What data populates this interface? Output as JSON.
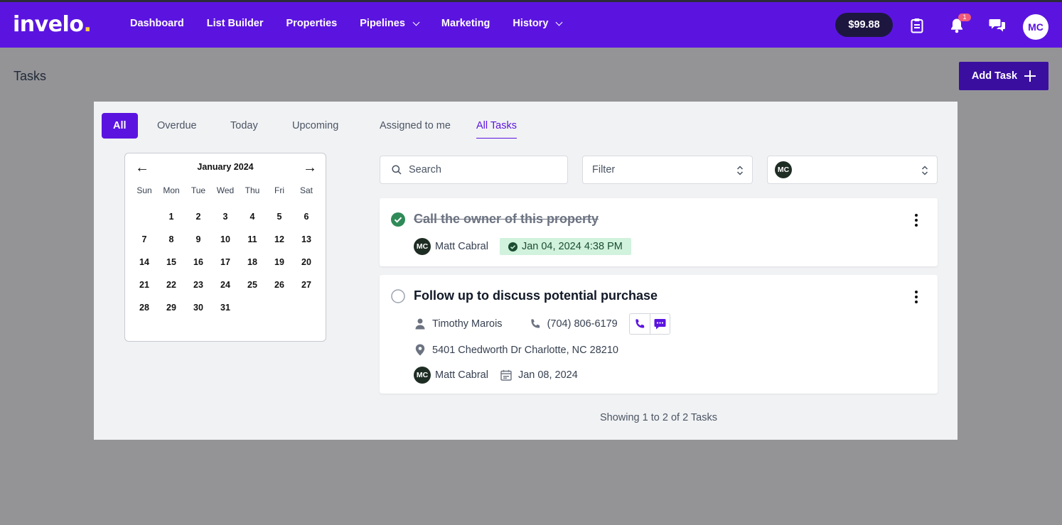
{
  "app": {
    "logo_text": "invelo",
    "logo_dot": ".",
    "nav": [
      {
        "label": "Dashboard"
      },
      {
        "label": "List Builder"
      },
      {
        "label": "Properties"
      },
      {
        "label": "Pipelines",
        "has_dropdown": true
      },
      {
        "label": "Marketing"
      },
      {
        "label": "History",
        "has_dropdown": true
      }
    ],
    "balance": "$99.88",
    "notification_count": "1",
    "user_initials": "MC",
    "icons": [
      "clipboard-icon",
      "bell-icon",
      "chat-icon"
    ],
    "brand_color": "#5b14e0"
  },
  "page": {
    "title": "Tasks",
    "add_task_label": "Add Task"
  },
  "tabs": {
    "status": [
      "All",
      "Overdue",
      "Today",
      "Upcoming"
    ],
    "active_status": "All",
    "scope": [
      "Assigned to me",
      "All Tasks"
    ],
    "active_scope": "All Tasks"
  },
  "calendar": {
    "month_label": "January 2024",
    "prev_icon": "arrow-left-icon",
    "next_icon": "arrow-right-icon",
    "weekdays": [
      "Sun",
      "Mon",
      "Tue",
      "Wed",
      "Thu",
      "Fri",
      "Sat"
    ],
    "first_weekday_index": 1,
    "days": [
      "1",
      "2",
      "3",
      "4",
      "5",
      "6",
      "7",
      "8",
      "9",
      "10",
      "11",
      "12",
      "13",
      "14",
      "15",
      "16",
      "17",
      "18",
      "19",
      "20",
      "21",
      "22",
      "23",
      "24",
      "25",
      "26",
      "27",
      "28",
      "29",
      "30",
      "31"
    ]
  },
  "filters": {
    "search_placeholder": "Search",
    "filter_label": "Filter",
    "assignee_initials": "MC"
  },
  "tasks": [
    {
      "title": "Call the owner of this property",
      "completed": true,
      "assignee_initials": "MC",
      "assignee": "Matt Cabral",
      "completed_at": "Jan 04, 2024 4:38 PM"
    },
    {
      "title": "Follow up to discuss potential purchase",
      "completed": false,
      "contact_name": "Timothy Marois",
      "contact_phone": "(704) 806-6179",
      "address": "5401 Chedworth Dr Charlotte, NC 28210",
      "assignee_initials": "MC",
      "assignee": "Matt Cabral",
      "due_date": "Jan 08, 2024"
    }
  ],
  "footer": {
    "count_text": "Showing 1 to 2 of 2 Tasks"
  }
}
